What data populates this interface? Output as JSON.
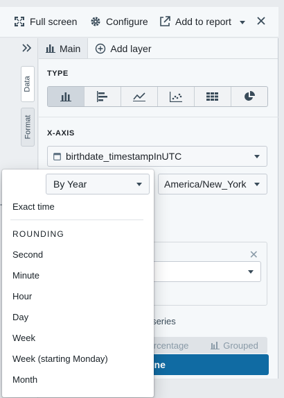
{
  "toolbar": {
    "full_screen": "Full screen",
    "configure": "Configure",
    "add_to_report": "Add to report"
  },
  "side_tabs": {
    "data": "Data",
    "format": "Format"
  },
  "tabs": {
    "main": "Main",
    "add_layer": "Add layer"
  },
  "type_section": {
    "label": "TYPE",
    "chart_types": [
      "bar-vertical-icon",
      "bar-horizontal-icon",
      "line-chart-icon",
      "scatter-icon",
      "heatmap-icon",
      "pie-chart-icon"
    ],
    "selected_index": 0
  },
  "x_axis": {
    "label": "X-AXIS",
    "field": "birthdate_timestampInUTC",
    "bucket": "By Year",
    "timezone": "America/New_York"
  },
  "series": {
    "add_label": "dd series"
  },
  "bottom_options": {
    "percentage": "ercentage",
    "grouped": "Grouped"
  },
  "done_label": "one",
  "stray_text": "T",
  "dropdown": {
    "exact_time": "Exact time",
    "rounding_header": "ROUNDING",
    "items": [
      "Second",
      "Minute",
      "Hour",
      "Day",
      "Week",
      "Week (starting Monday)",
      "Month"
    ]
  },
  "colors": {
    "accent": "#106ba3",
    "panel_bg": "#f5f8fa"
  }
}
